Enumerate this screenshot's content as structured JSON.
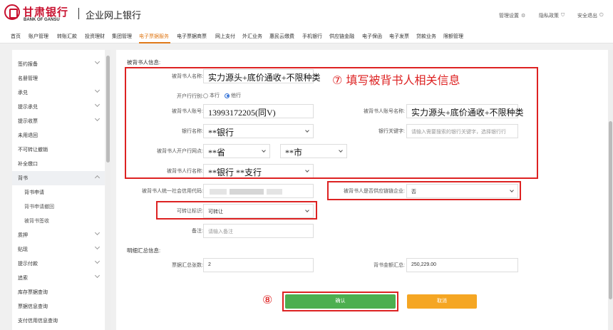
{
  "header": {
    "logo_cn": "甘肃银行",
    "logo_en": "BANK OF GANSU",
    "app_title": "企业网上银行",
    "links": {
      "settings": "管理设置",
      "privacy": "隐私政策",
      "logout": "安全退出"
    },
    "icons": {
      "settings": "gear-icon",
      "privacy": "shield-icon",
      "logout": "power-icon"
    }
  },
  "nav": {
    "items": [
      "首页",
      "账户管理",
      "转账汇款",
      "投资理财",
      "集团管理",
      "电子票据服务",
      "电子票据商票",
      "网上支付",
      "外汇业务",
      "惠民云缴费",
      "手机银行",
      "供应链金融",
      "电子保函",
      "电子发票",
      "贷款业务",
      "限额管理"
    ],
    "active": "电子票据服务"
  },
  "sidebar": {
    "items": [
      {
        "label": "签约报备",
        "expandable": true
      },
      {
        "label": "名册管理",
        "expandable": false
      },
      {
        "label": "承兑",
        "expandable": true
      },
      {
        "label": "提示承兑",
        "expandable": true
      },
      {
        "label": "提示收票",
        "expandable": true
      },
      {
        "label": "未用退回",
        "expandable": false
      },
      {
        "label": "不可转让撤销",
        "expandable": false
      },
      {
        "label": "补全缴口",
        "expandable": false
      },
      {
        "label": "背书",
        "expandable": true,
        "open": true
      },
      {
        "label": "背书申请",
        "sub": true
      },
      {
        "label": "背书申请撤回",
        "sub": true
      },
      {
        "label": "被背书签收",
        "sub": true
      },
      {
        "label": "质押",
        "expandable": true
      },
      {
        "label": "贴现",
        "expandable": true
      },
      {
        "label": "提示付款",
        "expandable": true
      },
      {
        "label": "追索",
        "expandable": true
      },
      {
        "label": "库存票据查询",
        "expandable": false
      },
      {
        "label": "票据信息查询",
        "expandable": false
      },
      {
        "label": "支付信用信息查询",
        "expandable": false
      }
    ]
  },
  "form": {
    "section_endorsee": "被背书人信息:",
    "name": {
      "label": "被背书人名称:",
      "value": "实力源头+底价通收+不限种类"
    },
    "bank_type": {
      "label": "开户行行别:",
      "option_own": "本行",
      "option_other": "他行",
      "selected": "他行"
    },
    "account": {
      "label": "被背书人账号:",
      "value": "13993172205(同V)"
    },
    "account_name": {
      "label": "被背书人账号名称:",
      "value": "实力源头+底价通收+不限种类"
    },
    "bank_name": {
      "label": "银行名称:",
      "value": "**银行"
    },
    "bank_keyword": {
      "label": "银行关键字:",
      "placeholder": "请输入需要搜索的银行关键字，选择银行行"
    },
    "branch": {
      "label": "被背书人开户行网点:",
      "province": "**省",
      "city": "**市"
    },
    "branch_name": {
      "label": "被背书人行名称:",
      "value": "**银行 **支行"
    },
    "credit_code": {
      "label": "被背书人统一社会信用代码:"
    },
    "supply_chain": {
      "label": "被背书人是否供应链链企业:",
      "value": "否"
    },
    "transferable": {
      "label": "可转让标识:",
      "value": "可转让"
    },
    "remark": {
      "label": "备注:",
      "placeholder": "请输入备注"
    },
    "section_summary": "明细汇总信息:",
    "count": {
      "label": "票据汇总张数:",
      "value": "2"
    },
    "amount": {
      "label": "背书金额汇总:",
      "value": "250,229.00"
    },
    "confirm_label": "确认",
    "cancel_label": "取消"
  },
  "annotations": {
    "step7_num": "⑦",
    "step7_text": "填写被背书人相关信息",
    "step8_num": "⑧"
  },
  "colors": {
    "brand": "#c8102e",
    "active_nav": "#e07a1a",
    "confirm": "#4caf50",
    "cancel": "#f5a623",
    "annotation": "#d22222"
  }
}
